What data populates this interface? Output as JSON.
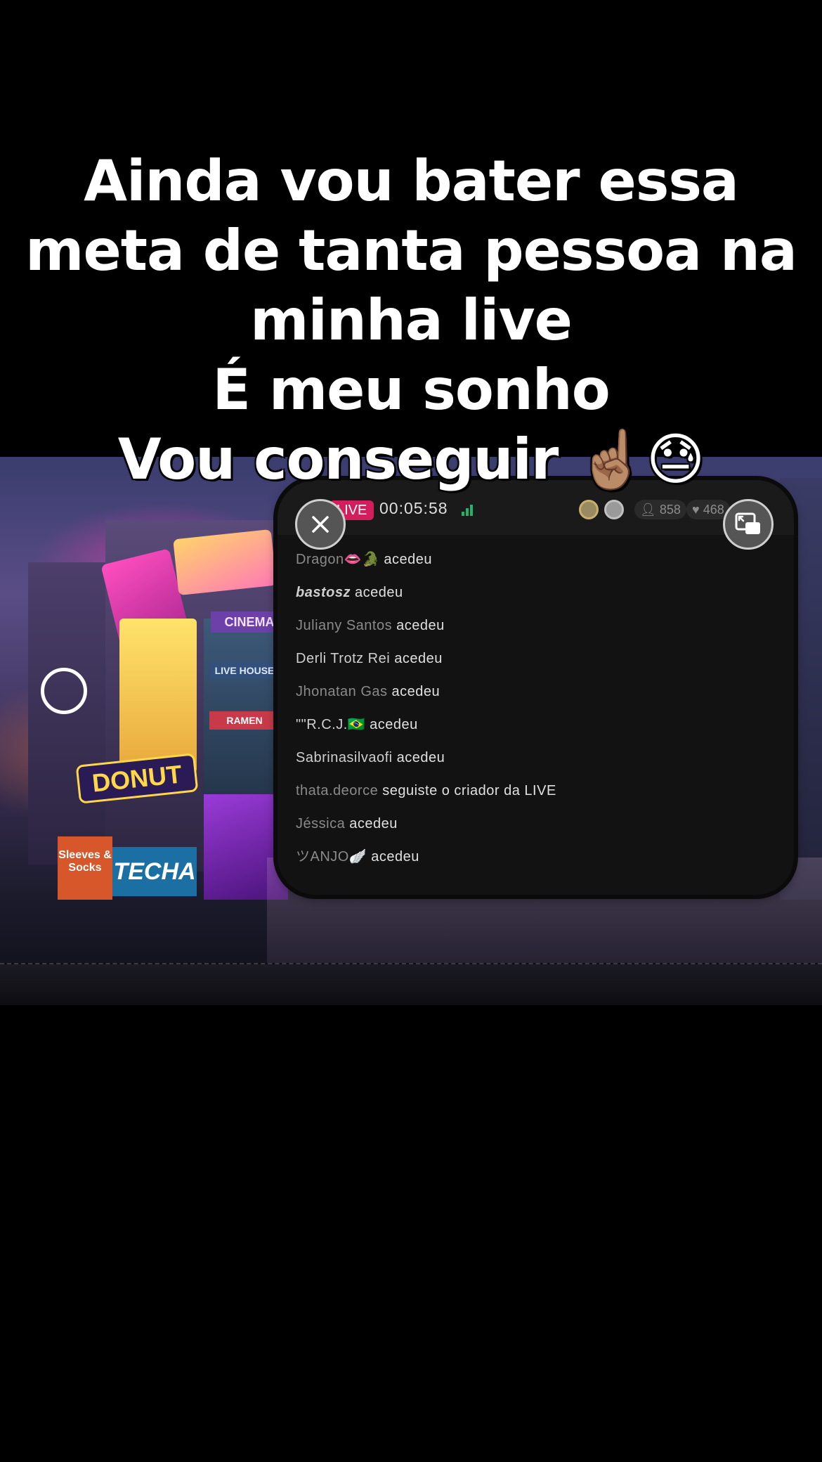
{
  "caption": {
    "lines": [
      "Ainda vou bater essa",
      "meta de tanta pessoa na",
      "minha live",
      "É meu sonho",
      "Vou conseguir ☝🏽😓"
    ]
  },
  "background": {
    "signs": {
      "cinema": "CINEMA",
      "live_house": "LIVE HOUSE",
      "ramen": "RAMEN",
      "donut": "DONUT",
      "sleeves": "Sleeves & Socks",
      "techa": "TECHA"
    }
  },
  "live_panel": {
    "badge": "LIVE",
    "timer": "00:05:58",
    "viewers": "858",
    "likes": "468",
    "colors": {
      "badge": "#d21e5c",
      "signal": "#1fb36b"
    },
    "feed": [
      {
        "user": "Dragon👄🐊",
        "action": "acedeu",
        "style": "dim"
      },
      {
        "user": "bastosz",
        "action": "acedeu",
        "style": "italic"
      },
      {
        "user": "Juliany Santos",
        "action": "acedeu",
        "style": "dim"
      },
      {
        "user": "Derli Trotz Rei",
        "action": "acedeu",
        "style": "bright"
      },
      {
        "user": "Jhonatan Gas",
        "action": "acedeu",
        "style": "dim"
      },
      {
        "user": "\"\"R.C.J.🇧🇷",
        "action": "acedeu",
        "style": "bright"
      },
      {
        "user": "Sabrinasilvaofi",
        "action": "acedeu",
        "style": "bright"
      },
      {
        "user": "thata.deorce",
        "action": "seguiste o criador da LIVE",
        "style": "dim"
      },
      {
        "user": "Jéssica",
        "action": "acedeu",
        "style": "dim"
      },
      {
        "user": "ツANJO🪽",
        "action": "acedeu",
        "style": "dim"
      }
    ]
  },
  "icons": {
    "close": "close-icon",
    "restore": "picture-in-picture-icon"
  }
}
